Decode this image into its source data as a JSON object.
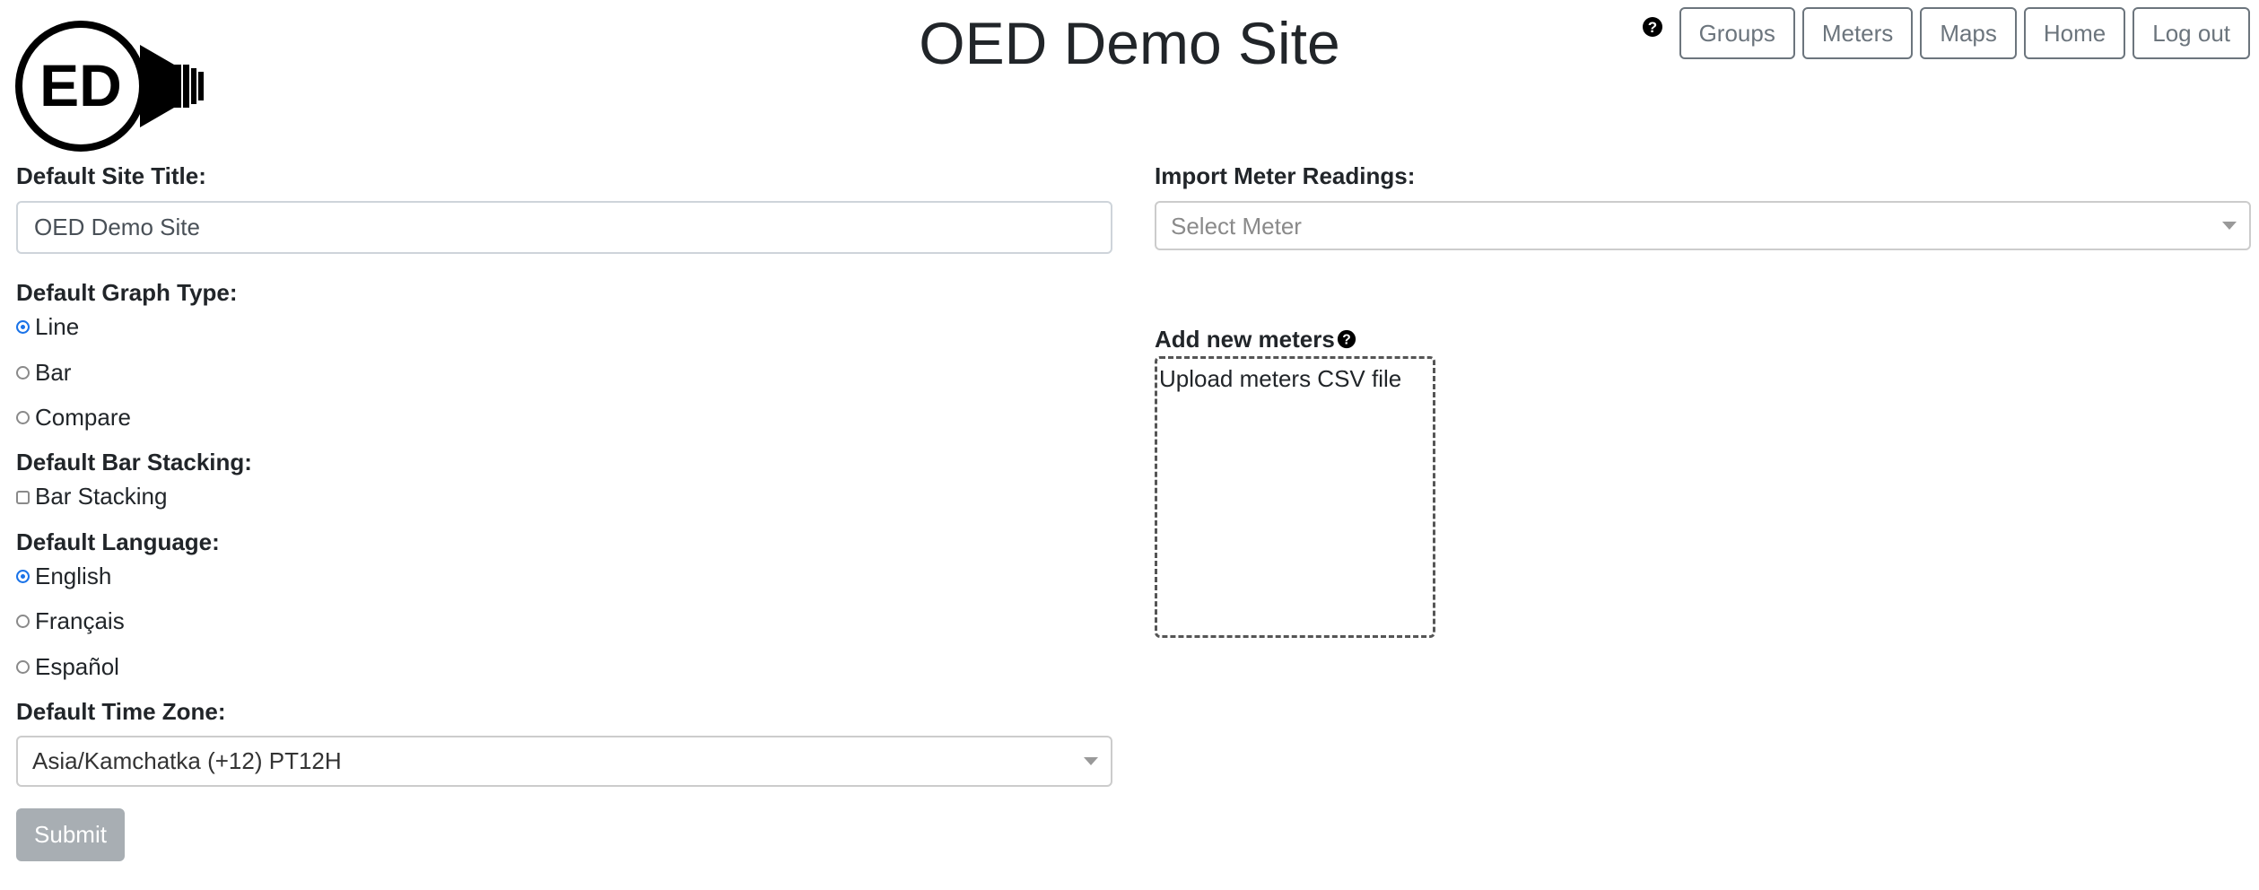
{
  "header": {
    "logo_text": "ED",
    "title": "OED Demo Site",
    "nav": [
      "Groups",
      "Meters",
      "Maps",
      "Home",
      "Log out"
    ]
  },
  "settings": {
    "site_title": {
      "label": "Default Site Title:",
      "value": "OED Demo Site"
    },
    "graph_type": {
      "label": "Default Graph Type:",
      "options": [
        "Line",
        "Bar",
        "Compare"
      ],
      "selected": "Line"
    },
    "bar_stacking": {
      "label": "Default Bar Stacking:",
      "option": "Bar Stacking",
      "checked": false
    },
    "language": {
      "label": "Default Language:",
      "options": [
        "English",
        "Français",
        "Español"
      ],
      "selected": "English"
    },
    "time_zone": {
      "label": "Default Time Zone:",
      "value": "Asia/Kamchatka (+12) PT12H"
    },
    "submit_label": "Submit"
  },
  "import": {
    "label": "Import Meter Readings:",
    "placeholder": "Select Meter"
  },
  "add_meters": {
    "label": "Add new meters",
    "dropzone_text": "Upload meters CSV file"
  },
  "colors": {
    "accent_radio": "#1a73e8",
    "submit_bg": "#a8aeb3",
    "outline_button": "#6c757d"
  }
}
